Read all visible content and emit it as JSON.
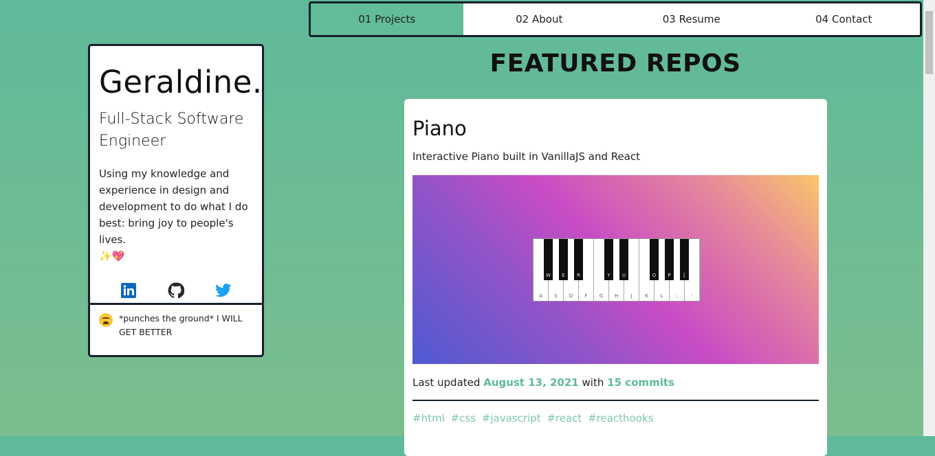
{
  "nav": {
    "items": [
      "01 Projects",
      "02 About",
      "03 Resume",
      "04 Contact"
    ],
    "active_index": 0
  },
  "profile": {
    "name": "Geraldine.",
    "role": "Full-Stack Software Engineer",
    "bio": "Using my knowledge and experience in design and development to do what I do best: bring joy to people's lives.",
    "bio_emoji": "✨💖",
    "socials": [
      {
        "icon": "linkedin-icon",
        "color": "#0a66c2"
      },
      {
        "icon": "github-icon",
        "color": "#24292e"
      },
      {
        "icon": "twitter-icon",
        "color": "#1da1f2"
      }
    ],
    "status": "*punches the ground* I WILL GET BETTER"
  },
  "featured": {
    "title": "FEATURED REPOS"
  },
  "repo": {
    "name": "Piano",
    "description": "Interactive Piano built in VanillaJS and React",
    "updated_prefix": "Last updated",
    "updated_date": "August 13, 2021",
    "with_text": "with",
    "commits": "15 commits",
    "tags": [
      "#html",
      "#css",
      "#javascript",
      "#react",
      "#reacthooks"
    ],
    "white_keys": [
      "A",
      "S",
      "D",
      "F",
      "G",
      "H",
      "J",
      "K",
      "L",
      ";",
      "'"
    ],
    "black_keys": [
      "W",
      "E",
      "R",
      "Y",
      "U",
      "O",
      "P",
      "["
    ]
  },
  "colors": {
    "accent": "#62bb99",
    "border": "#14202b",
    "link": "#5fba9a"
  }
}
